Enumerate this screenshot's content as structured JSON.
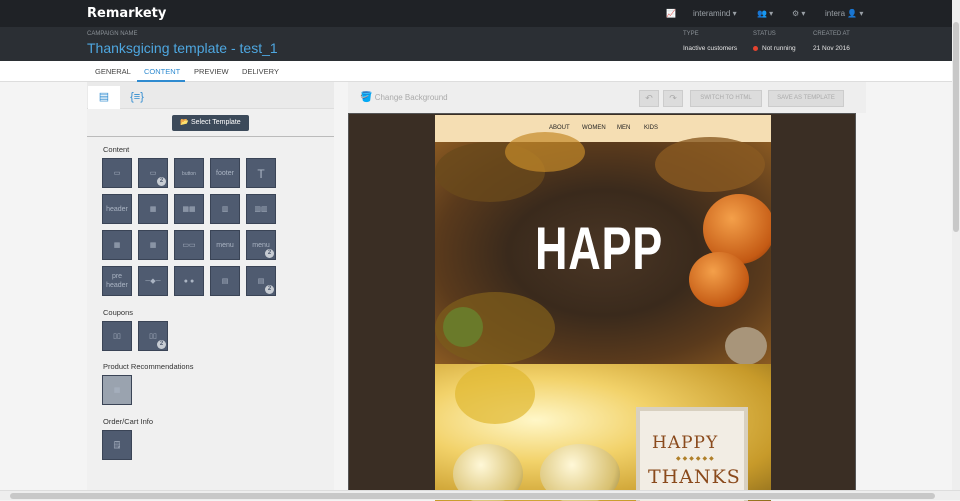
{
  "app": {
    "logo": "Remarkety"
  },
  "topbar": {
    "account": "interamind",
    "user": "intera"
  },
  "campaign": {
    "label": "CAMPAIGN NAME",
    "name": "Thanksgicing template - test_1"
  },
  "meta": {
    "type_label": "TYPE",
    "type_value": "Inactive customers",
    "status_label": "STATUS",
    "status_value": "Not running",
    "created_label": "CREATED AT",
    "created_value": "21 Nov 2016"
  },
  "tabs": [
    "GENERAL",
    "CONTENT",
    "PREVIEW",
    "DELIVERY"
  ],
  "left": {
    "select_template": "Select Template",
    "sections": {
      "content": "Content",
      "coupons": "Coupons",
      "product": "Product Recommendations",
      "order": "Order/Cart Info"
    },
    "tiles": {
      "button": "button",
      "footer": "footer",
      "header": "header",
      "menu": "menu",
      "preheader": "pre header",
      "t": "T"
    },
    "badge": "2"
  },
  "toolbar": {
    "change_bg": "Change Background",
    "switch": "SWITCH TO HTML",
    "save": "SAVE AS TEMPLATE",
    "undo": "↶",
    "redo": "↷"
  },
  "email": {
    "nav": [
      "ABOUT",
      "WOMEN",
      "MEN",
      "KIDS"
    ],
    "hero_text": "HAPP",
    "card_line1": "HAPPY",
    "card_dots": "◆◆◆◆◆◆",
    "card_line2": "THANKS"
  }
}
